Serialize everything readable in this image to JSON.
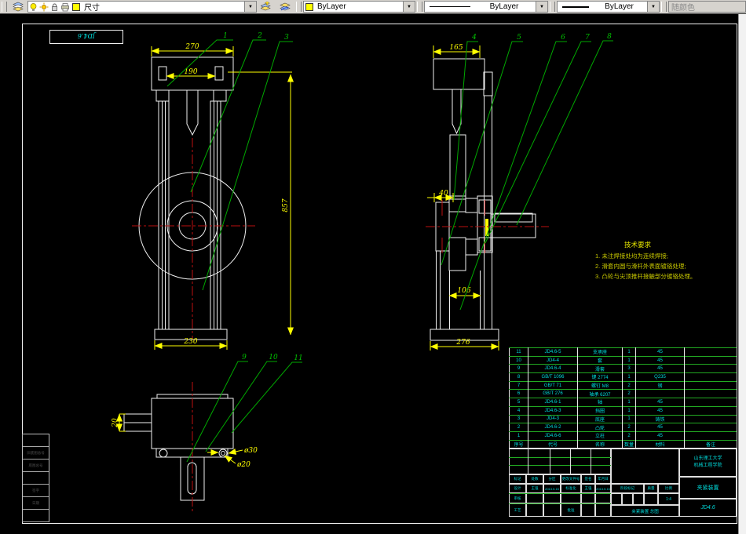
{
  "toolbar": {
    "layer_field": "尺寸",
    "color_field": "ByLayer",
    "linetype_field": "ByLayer",
    "lineweight_field": "ByLayer",
    "plot_style_field": "随颜色"
  },
  "frame": {
    "corner_code": "JD4.6"
  },
  "views": {
    "front": {
      "dim_width_top": "270",
      "dim_width_inner": "190",
      "dim_width_base": "230",
      "dim_height": "857",
      "leaders": [
        "1",
        "2",
        "3"
      ]
    },
    "side": {
      "dim_width_top": "165",
      "dim_offset": "40",
      "dim_inner": "106",
      "dim_base": "276",
      "leaders": [
        "4",
        "5",
        "6",
        "7",
        "8"
      ]
    },
    "top": {
      "dim_stub": "20",
      "dim_dia_outer": "ø30",
      "dim_dia_inner": "ø20",
      "leaders": [
        "9",
        "10",
        "11"
      ]
    }
  },
  "tech_req": {
    "title": "技术要求",
    "items": [
      "1. 未注焊接处均为连续焊接;",
      "2. 滑套内圆与滑杆外表面镀铬处理;",
      "3. 凸轮与尖顶推杆接触部分镀铬处理。"
    ]
  },
  "bom": {
    "headers": [
      "序号",
      "代号",
      "名称",
      "数量",
      "材料",
      "备注"
    ],
    "rows": [
      [
        "11",
        "JD4.6-5",
        "支承座",
        "1",
        "45",
        ""
      ],
      [
        "10",
        "JD4-4",
        "套",
        "1",
        "45",
        ""
      ],
      [
        "9",
        "JD4.6-4",
        "滑套",
        "3",
        "45",
        ""
      ],
      [
        "8",
        "GB/T 1096",
        "键 2774",
        "1",
        "Q235",
        ""
      ],
      [
        "7",
        "GB/T 71",
        "螺钉 M8",
        "2",
        "钢",
        ""
      ],
      [
        "6",
        "GB/T 276",
        "轴承 6207",
        "2",
        "",
        ""
      ],
      [
        "5",
        "JD4.6-1",
        "轴",
        "1",
        "45",
        ""
      ],
      [
        "4",
        "JD4.6-3",
        "挡圈",
        "1",
        "45",
        ""
      ],
      [
        "3",
        "JD4-3",
        "底座",
        "1",
        "铸铁",
        ""
      ],
      [
        "2",
        "JD4.6-2",
        "凸轮",
        "2",
        "45",
        ""
      ],
      [
        "1",
        "JD4.6-6",
        "立柱",
        "2",
        "45",
        ""
      ]
    ]
  },
  "title_block": {
    "row_marks": [
      "标记",
      "处数",
      "分区",
      "更改文件号",
      "签名",
      "年月日"
    ],
    "design_label": "设计",
    "design_name": "王强",
    "design_date": "2013.5.15",
    "standard_label": "标准化",
    "standard_name": "王强",
    "standard_date": "2013.5.15",
    "audit_label": "审核",
    "process_label": "工艺",
    "approve_label": "批准",
    "stage_label": "阶段标记",
    "mass_label": "质量",
    "scale_label": "比例",
    "scale_value": "1:4",
    "sheet_info": "夹紧装置 总图",
    "org_line1": "山东理工大学",
    "org_line2": "机械工程学院",
    "product_name": "夹紧装置",
    "drawing_no": "JD4.6"
  },
  "left_strip": {
    "rows": [
      "",
      "旧底图总号",
      "底图总号",
      "",
      "签字",
      "日期",
      ""
    ]
  }
}
